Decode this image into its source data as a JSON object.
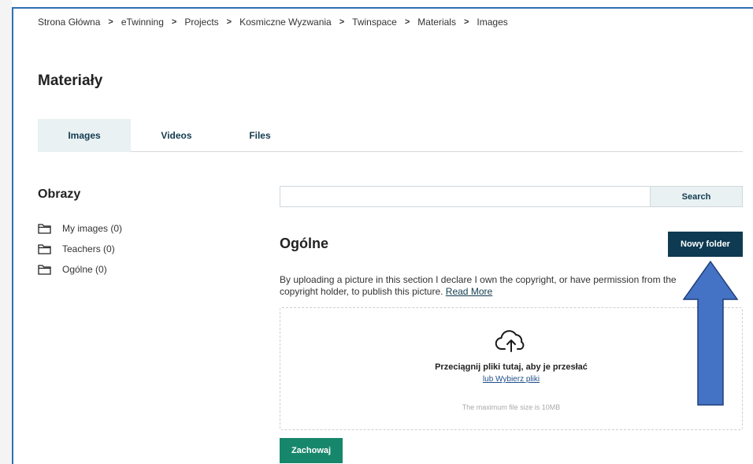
{
  "breadcrumb": [
    "Strona Główna",
    "eTwinning",
    "Projects",
    "Kosmiczne Wyzwania",
    "Twinspace",
    "Materials",
    "Images"
  ],
  "page_title": "Materiały",
  "tabs": [
    {
      "label": "Images",
      "active": true
    },
    {
      "label": "Videos",
      "active": false
    },
    {
      "label": "Files",
      "active": false
    }
  ],
  "sidebar": {
    "title": "Obrazy",
    "folders": [
      {
        "label": "My images (0)",
        "icon": "folder-icon"
      },
      {
        "label": "Teachers (0)",
        "icon": "folder-icon"
      },
      {
        "label": "Ogólne (0)",
        "icon": "folder-icon"
      }
    ]
  },
  "search": {
    "placeholder": "",
    "value": "",
    "button_label": "Search"
  },
  "section": {
    "title": "Ogólne",
    "new_folder_label": "Nowy folder",
    "notice_text": "By uploading a picture in this section I declare I own the copyright, or have permission from the copyright holder, to publish this picture.",
    "notice_link": "Read More"
  },
  "dropzone": {
    "icon": "cloud-upload-icon",
    "title": "Przeciągnij pliki tutaj, aby je przesłać",
    "link": "lub Wybierz pliki",
    "max_size": "The maximum file size is 10MB"
  },
  "save_label": "Zachowaj",
  "colors": {
    "frame_border": "#2f6fb5",
    "tab_active_bg": "#e9f1f2",
    "primary_dark": "#0e3a52",
    "save_green": "#17876b",
    "annotation_arrow": "#4472c4"
  }
}
